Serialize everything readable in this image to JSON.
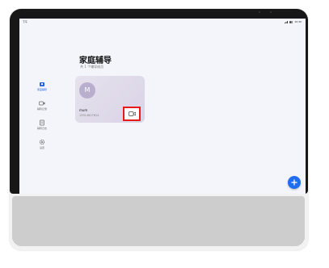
{
  "status_bar": {
    "left": "下午",
    "time": "10:30"
  },
  "nav": {
    "items": [
      {
        "label": "家庭辅导",
        "icon": "family-tutoring-icon",
        "active": true
      },
      {
        "label": "辅导记录",
        "icon": "video-record-icon",
        "active": false
      },
      {
        "label": "辅导日志",
        "icon": "log-book-icon",
        "active": false
      },
      {
        "label": "设置",
        "icon": "settings-icon",
        "active": false
      }
    ]
  },
  "page": {
    "title": "家庭辅导",
    "subtitle": "共 1 个辅导成员"
  },
  "member_card": {
    "avatar_letter": "M",
    "name": "mum",
    "phone": "15914807624",
    "call_icon": "video-call-icon"
  },
  "fab_icon": "plus-icon",
  "colors": {
    "accent": "#1f6ef0",
    "highlight": "#e8191a",
    "card": "#ddd7e8"
  }
}
